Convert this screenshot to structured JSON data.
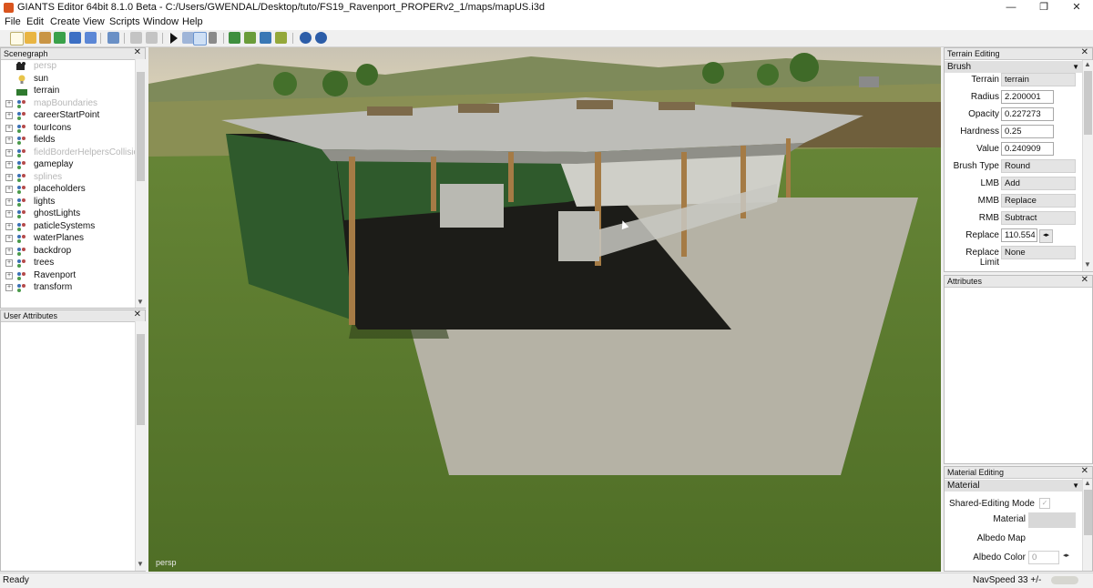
{
  "window": {
    "title": "GIANTS Editor 64bit 8.1.0 Beta - C:/Users/GWENDAL/Desktop/tuto/FS19_Ravenport_PROPERv2_1/maps/mapUS.i3d",
    "minimize": "—",
    "maximize": "❐",
    "close": "✕"
  },
  "menu": [
    "File",
    "Edit",
    "Create",
    "View",
    "Scripts",
    "Window",
    "Help"
  ],
  "scenegraph": {
    "title": "Scenegraph",
    "close": "✕",
    "items": [
      {
        "label": "persp",
        "grey": true,
        "expandable": false,
        "icon": "camera-icon"
      },
      {
        "label": "sun",
        "grey": false,
        "expandable": false,
        "icon": "light-bulb-icon"
      },
      {
        "label": "terrain",
        "grey": false,
        "expandable": false,
        "icon": "terrain-icon"
      },
      {
        "label": "mapBoundaries",
        "grey": true,
        "expandable": true,
        "icon": "transform-group-icon"
      },
      {
        "label": "careerStartPoint",
        "grey": false,
        "expandable": true,
        "icon": "transform-group-icon"
      },
      {
        "label": "tourIcons",
        "grey": false,
        "expandable": true,
        "icon": "transform-group-icon"
      },
      {
        "label": "fields",
        "grey": false,
        "expandable": true,
        "icon": "transform-group-icon"
      },
      {
        "label": "fieldBorderHelpersCollisio",
        "grey": true,
        "expandable": true,
        "icon": "transform-group-icon"
      },
      {
        "label": "gameplay",
        "grey": false,
        "expandable": true,
        "icon": "transform-group-icon"
      },
      {
        "label": "splines",
        "grey": true,
        "expandable": true,
        "icon": "transform-group-icon"
      },
      {
        "label": "placeholders",
        "grey": false,
        "expandable": true,
        "icon": "transform-group-icon"
      },
      {
        "label": "lights",
        "grey": false,
        "expandable": true,
        "icon": "transform-group-icon"
      },
      {
        "label": "ghostLights",
        "grey": false,
        "expandable": true,
        "icon": "transform-group-icon"
      },
      {
        "label": "paticleSystems",
        "grey": false,
        "expandable": true,
        "icon": "transform-group-icon"
      },
      {
        "label": "waterPlanes",
        "grey": false,
        "expandable": true,
        "icon": "transform-group-icon"
      },
      {
        "label": "backdrop",
        "grey": false,
        "expandable": true,
        "icon": "transform-group-icon"
      },
      {
        "label": "trees",
        "grey": false,
        "expandable": true,
        "icon": "transform-group-icon"
      },
      {
        "label": "Ravenport",
        "grey": false,
        "expandable": true,
        "icon": "transform-group-icon"
      },
      {
        "label": "transform",
        "grey": false,
        "expandable": true,
        "icon": "transform-group-icon"
      }
    ]
  },
  "user_attributes": {
    "title": "User Attributes",
    "close": "✕"
  },
  "viewport": {
    "camera_label": "persp"
  },
  "terrain_editing": {
    "title": "Terrain Editing",
    "close": "✕",
    "brush_section": "Brush",
    "fields": [
      {
        "label": "Terrain",
        "value": "terrain",
        "kind": "combo"
      },
      {
        "label": "Radius",
        "value": "2.200001",
        "kind": "input"
      },
      {
        "label": "Opacity",
        "value": "0.227273",
        "kind": "input"
      },
      {
        "label": "Hardness",
        "value": "0.25",
        "kind": "input"
      },
      {
        "label": "Value",
        "value": "0.240909",
        "kind": "input"
      },
      {
        "label": "Brush Type",
        "value": "Round",
        "kind": "combo"
      },
      {
        "label": "LMB",
        "value": "Add",
        "kind": "combo"
      },
      {
        "label": "MMB",
        "value": "Replace",
        "kind": "combo"
      },
      {
        "label": "RMB",
        "value": "Subtract",
        "kind": "combo"
      },
      {
        "label": "Replace",
        "value": "110.554",
        "kind": "spin"
      },
      {
        "label": "Replace Limit",
        "value": "None",
        "kind": "combo"
      }
    ]
  },
  "attributes": {
    "title": "Attributes",
    "close": "✕"
  },
  "material_editing": {
    "title": "Material Editing",
    "close": "✕",
    "material_section": "Material",
    "shared_mode_label": "Shared-Editing Mode",
    "shared_mode_check": "✓",
    "material_label": "Material",
    "albedo_map_label": "Albedo Map",
    "albedo_color_label": "Albedo Color",
    "albedo_color_value": "0"
  },
  "status": {
    "left": "Ready",
    "right": "NavSpeed 33 +/-"
  },
  "colors": {
    "accent": "#0078d7",
    "barn_green": "#2f5a2c",
    "grass": "#5d7a2f"
  }
}
